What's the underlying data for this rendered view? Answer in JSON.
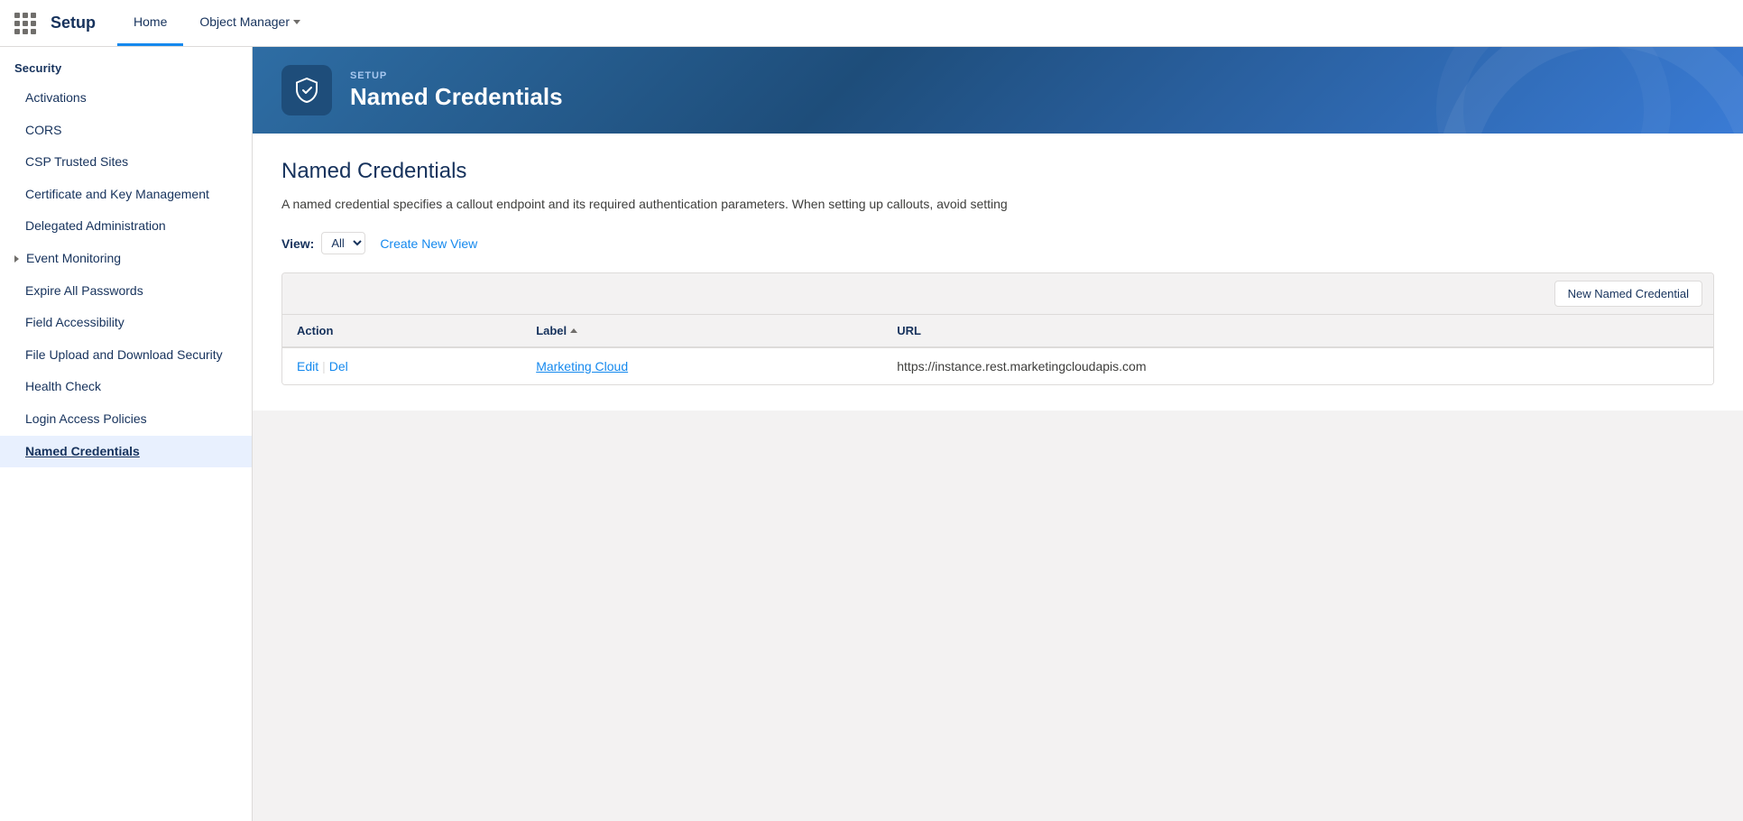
{
  "topNav": {
    "appLauncherLabel": "App Launcher",
    "setupTitle": "Setup",
    "tabs": [
      {
        "id": "home",
        "label": "Home",
        "active": true
      },
      {
        "id": "object-manager",
        "label": "Object Manager",
        "hasChevron": true
      }
    ]
  },
  "sidebar": {
    "sectionHeader": "Security",
    "items": [
      {
        "id": "activations",
        "label": "Activations",
        "active": false,
        "hasChevron": false
      },
      {
        "id": "cors",
        "label": "CORS",
        "active": false,
        "hasChevron": false
      },
      {
        "id": "csp-trusted-sites",
        "label": "CSP Trusted Sites",
        "active": false,
        "hasChevron": false
      },
      {
        "id": "certificate-key-mgmt",
        "label": "Certificate and Key Management",
        "active": false,
        "hasChevron": false
      },
      {
        "id": "delegated-admin",
        "label": "Delegated Administration",
        "active": false,
        "hasChevron": false
      },
      {
        "id": "event-monitoring",
        "label": "Event Monitoring",
        "active": false,
        "hasChevron": true
      },
      {
        "id": "expire-all-passwords",
        "label": "Expire All Passwords",
        "active": false,
        "hasChevron": false
      },
      {
        "id": "field-accessibility",
        "label": "Field Accessibility",
        "active": false,
        "hasChevron": false
      },
      {
        "id": "file-upload-download",
        "label": "File Upload and Download Security",
        "active": false,
        "hasChevron": false
      },
      {
        "id": "health-check",
        "label": "Health Check",
        "active": false,
        "hasChevron": false
      },
      {
        "id": "login-access-policies",
        "label": "Login Access Policies",
        "active": false,
        "hasChevron": false
      },
      {
        "id": "named-credentials",
        "label": "Named Credentials",
        "active": true,
        "hasChevron": false
      }
    ]
  },
  "pageHeader": {
    "setupLabel": "SETUP",
    "pageTitle": "Named Credentials"
  },
  "mainContent": {
    "title": "Named Credentials",
    "description": "A named credential specifies a callout endpoint and its required authentication parameters. When setting up callouts, avoid setting",
    "viewBar": {
      "label": "View:",
      "selectOptions": [
        "All"
      ],
      "selectedOption": "All",
      "createNewViewLabel": "Create New View"
    },
    "table": {
      "newButtonLabel": "New Named Credential",
      "columns": [
        {
          "id": "action",
          "label": "Action"
        },
        {
          "id": "label",
          "label": "Label",
          "sortable": true
        },
        {
          "id": "url",
          "label": "URL"
        }
      ],
      "rows": [
        {
          "id": "row-1",
          "action": {
            "editLabel": "Edit",
            "delLabel": "Del"
          },
          "label": "Marketing Cloud",
          "url": "https://instance.rest.marketingcloudapis.com"
        }
      ]
    }
  }
}
